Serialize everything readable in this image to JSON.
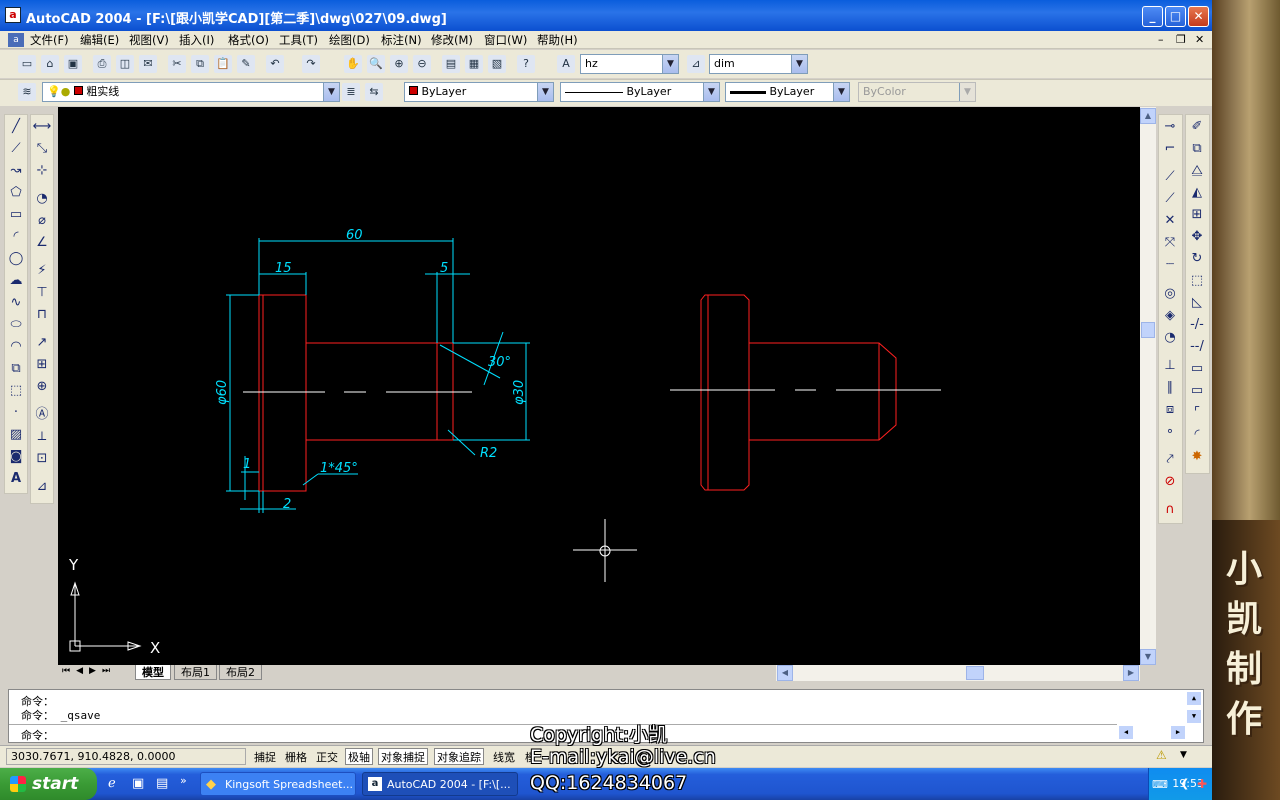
{
  "window": {
    "title": "AutoCAD 2004 - [F:\\[跟小凯学CAD][第二季]\\dwg\\027\\09.dwg]"
  },
  "menu": [
    "文件(F)",
    "编辑(E)",
    "视图(V)",
    "插入(I)",
    "格式(O)",
    "工具(T)",
    "绘图(D)",
    "标注(N)",
    "修改(M)",
    "窗口(W)",
    "帮助(H)"
  ],
  "toolbar": {
    "text_style": "hz",
    "dim_style": "dim"
  },
  "layers": {
    "current_layer": "粗实线",
    "color": "ByLayer",
    "linetype": "ByLayer",
    "lineweight": "ByLayer",
    "plotstyle": "ByColor"
  },
  "drawing": {
    "dims": {
      "d60": "60",
      "d15": "15",
      "d5": "5",
      "phi60": "φ60",
      "phi30": "φ30",
      "ang": "30°",
      "r2": "R2",
      "d1": "1",
      "d2": "2",
      "chamfer": "1*45°"
    },
    "ucs": {
      "x": "X",
      "y": "Y"
    }
  },
  "layout_tabs": [
    "模型",
    "布局1",
    "布局2"
  ],
  "command": {
    "line1": "命令：",
    "line2": "命令： _qsave",
    "prompt": "命令："
  },
  "status": {
    "coords": "3030.7671, 910.4828, 0.0000",
    "buttons": [
      "捕捉",
      "栅格",
      "正交",
      "极轴",
      "对象捕捉",
      "对象追踪",
      "线宽",
      "模型"
    ]
  },
  "taskbar": {
    "start": "start",
    "tasks": [
      "Kingsoft Spreadsheet...",
      "AutoCAD 2004 - [F:\\[..."
    ],
    "clock": "19:53"
  },
  "overlay": {
    "copyright": "Copyright:小凯",
    "email": "E-mail:ykai@live.cn",
    "qq": "QQ:1624834067"
  },
  "side_banner": [
    "小",
    "凯",
    "制",
    "作"
  ]
}
